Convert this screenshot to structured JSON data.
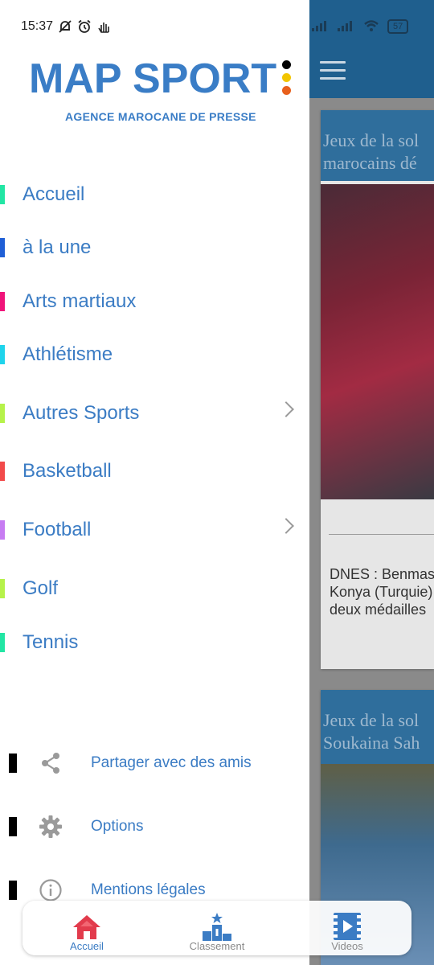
{
  "status_bar": {
    "time": "15:37",
    "battery": "57"
  },
  "logo": {
    "title": "MAP SPORT",
    "subtitle": "AGENCE MAROCANE DE PRESSE",
    "dot_colors": [
      "#000000",
      "#f2c500",
      "#e8601c"
    ]
  },
  "nav": {
    "items": [
      {
        "label": "Accueil",
        "color": "#22e6a4",
        "has_submenu": false
      },
      {
        "label": "à la une",
        "color": "#1f5fd6",
        "has_submenu": false
      },
      {
        "label": "Arts martiaux",
        "color": "#f0147a",
        "has_submenu": false
      },
      {
        "label": "Athlétisme",
        "color": "#1fd4ec",
        "has_submenu": false
      },
      {
        "label": "Autres Sports",
        "color": "#b6f24a",
        "has_submenu": true
      },
      {
        "label": "Basketball",
        "color": "#f24a4a",
        "has_submenu": false
      },
      {
        "label": "Football",
        "color": "#c77cf2",
        "has_submenu": true
      },
      {
        "label": "Golf",
        "color": "#b6f24a",
        "has_submenu": false
      },
      {
        "label": "Tennis",
        "color": "#22e6a4",
        "has_submenu": false
      }
    ]
  },
  "secondary": {
    "items": [
      {
        "label": "Partager avec des amis",
        "icon": "share-icon"
      },
      {
        "label": "Options",
        "icon": "gear-icon"
      },
      {
        "label": "Mentions légales",
        "icon": "info-icon"
      }
    ]
  },
  "background": {
    "card1_title_line1": "Jeux de la sol",
    "card1_title_line2": "marocains dé",
    "card1_text_line1": "DNES : Benmas",
    "card1_text_line2": "Konya (Turquie)",
    "card1_text_line3": "deux médailles",
    "card2_title_line1": "Jeux de la sol",
    "card2_title_line2": "Soukaina Sah"
  },
  "bottom_nav": {
    "items": [
      {
        "label": "Accueil",
        "icon": "home-icon",
        "active": true
      },
      {
        "label": "Classement",
        "icon": "podium-icon",
        "active": false
      },
      {
        "label": "Videos",
        "icon": "video-icon",
        "active": false
      }
    ],
    "active_color": "#e23b4c",
    "inactive_color": "#3b7cc4"
  }
}
